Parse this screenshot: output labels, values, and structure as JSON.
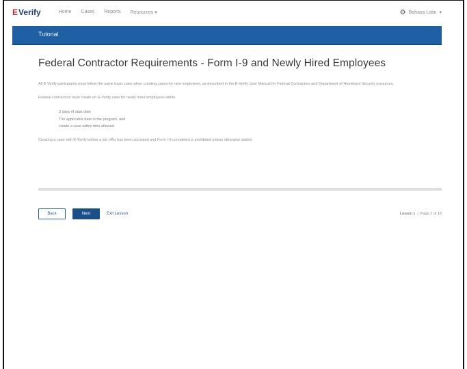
{
  "app": {
    "logo_prefix": "E",
    "logo_text": "Verify"
  },
  "nav": {
    "links": [
      "Home",
      "Cases",
      "Reports",
      "Resources"
    ],
    "language": "Bahasa Latin"
  },
  "banner": {
    "title": "Tutorial"
  },
  "main": {
    "heading": "Federal Contractor Requirements - Form I-9 and Newly Hired Employees",
    "para1": "All E-Verify participants must follow the same basic rules when creating cases for new employees, as described in the E-Verify User Manual for Federal Contractors and Department of Homeland Security resources.",
    "para2": "Federal contractors must create an E-Verify case for newly hired employees within:",
    "list": [
      "3 days of start date",
      "The applicable date in the program, and",
      "create a case within time allowed."
    ],
    "para3": "Creating a case with E-Verify before a job offer has been accepted and Form I-9 completed is prohibited unless otherwise stated."
  },
  "footer": {
    "back_label": "Back",
    "next_label": "Next",
    "exit_label": "Exit Lesson",
    "lesson_label": "Lesson 1",
    "page_label": "Page 2 of 18"
  }
}
